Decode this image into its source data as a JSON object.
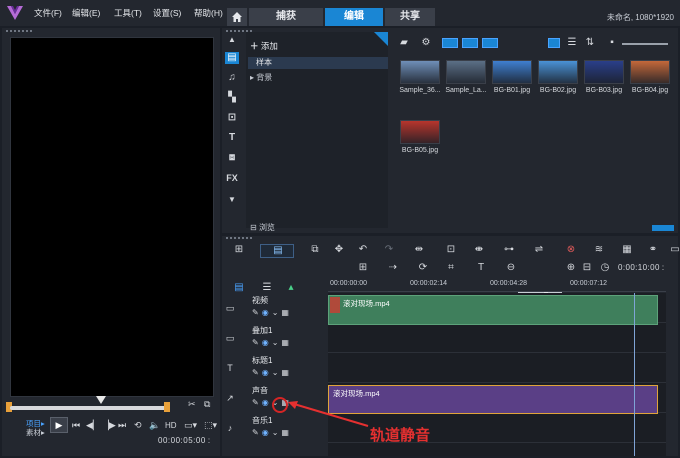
{
  "menu": {
    "items": [
      "文件(F)",
      "编辑(E)",
      "工具(T)",
      "设置(S)",
      "帮助(H)"
    ]
  },
  "tabs": {
    "home_icon": "home-icon",
    "items": [
      "捕获",
      "编辑",
      "共享"
    ],
    "active": "编辑"
  },
  "project_info": "未命名, 1080*1920",
  "player": {
    "mode_project": "项目▸",
    "mode_clip": "素材▸",
    "hd": "HD",
    "timecode": "00:00:05:00 :"
  },
  "library": {
    "add_label": "添加",
    "tree": [
      {
        "label": "样本",
        "selected": true
      },
      {
        "label": "▸ 背景",
        "selected": false
      }
    ],
    "browse_label": "浏览",
    "thumbnails": [
      {
        "label": "Sample_36...",
        "color": "#6f8fb8"
      },
      {
        "label": "Sample_La...",
        "color": "#5b6f86"
      },
      {
        "label": "BG-B01.jpg",
        "color": "#3f7fd0"
      },
      {
        "label": "BG-B02.jpg",
        "color": "#4a92d6"
      },
      {
        "label": "BG-B03.jpg",
        "color": "#2a3f8a"
      },
      {
        "label": "BG-B04.jpg",
        "color": "#c4683a"
      },
      {
        "label": "BG-B05.jpg",
        "color": "#b8352c"
      }
    ]
  },
  "timeline": {
    "time": "0:00:10:00 :",
    "ruler": [
      "00:00:00:00",
      "00:00:02:14",
      "00:00:04:28",
      "00:00:07:12"
    ],
    "tracks": [
      {
        "name": "视频",
        "icon": "video-track-icon"
      },
      {
        "name": "叠加1",
        "icon": "overlay-track-icon"
      },
      {
        "name": "标题1",
        "icon": "title-track-icon"
      },
      {
        "name": "声音",
        "icon": "voice-track-icon"
      },
      {
        "name": "音乐1",
        "icon": "music-track-icon"
      }
    ],
    "video_clip_label": "滚对现场.mp4",
    "audio_clip_label": "滚对现场.mp4"
  },
  "annotation": {
    "label": "轨道静音"
  },
  "colors": {
    "accent": "#1a86d4",
    "video_clip": "#3f7f5c",
    "audio_clip": "#5a3f86",
    "annotation": "#e53030"
  }
}
